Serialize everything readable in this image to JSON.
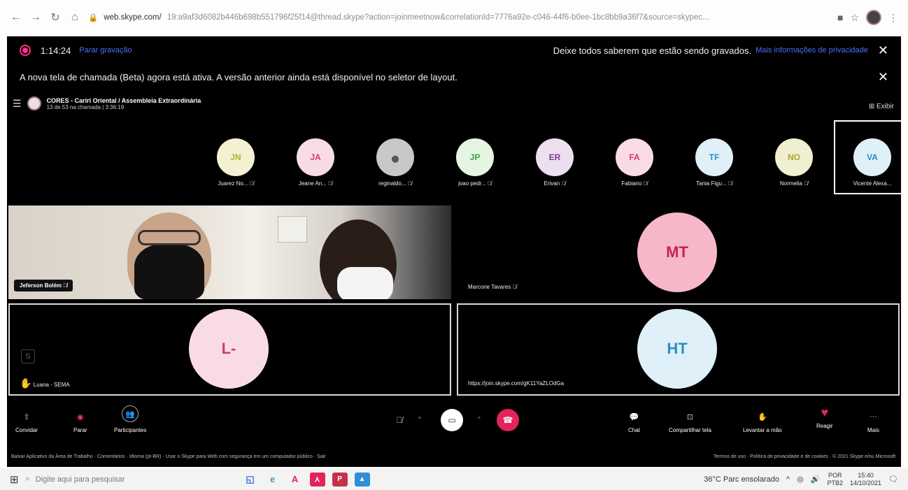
{
  "browser": {
    "url_host": "web.skype.com/",
    "url_rest": "19:a9af3d6082b446b698b551796f25f14@thread.skype?action=joinmeetnow&correlationId=7776a92e-c046-44f6-b0ee-1bc8bb9a36f7&source=skypec..."
  },
  "recording": {
    "time": "1:14:24",
    "stop_label": "Parar gravação",
    "notice": "Deixe todos saberem que estão sendo gravados.",
    "privacy_link": "Mais informações de privacidade"
  },
  "beta_notice": "A nova tela de chamada (Beta) agora está ativa. A versão anterior ainda está disponível no seletor de layout.",
  "call": {
    "title": "CORES - Cariri Oriental / Assembleia Extraordinária",
    "subtitle": "13 de 53 na chamada | 3:36:19",
    "view_label": "Exibir"
  },
  "participants": [
    {
      "initials": "JN",
      "name": "Juarez No...",
      "bg": "#f3f1d2",
      "fg": "#b8b23a"
    },
    {
      "initials": "JA",
      "name": "Jeane An...",
      "bg": "#f9dbe6",
      "fg": "#d23a6e"
    },
    {
      "initials": "",
      "name": "reginaldo...",
      "bg": "#c8c8c8",
      "fg": "#333"
    },
    {
      "initials": "JP",
      "name": "joao pedr...",
      "bg": "#e6f5e2",
      "fg": "#3aa04a"
    },
    {
      "initials": "ER",
      "name": "Erivan",
      "bg": "#ece0f0",
      "fg": "#7a3c8e"
    },
    {
      "initials": "FA",
      "name": "Fabiano",
      "bg": "#f9dbe6",
      "fg": "#d23a6e"
    },
    {
      "initials": "TF",
      "name": "Tania Figu...",
      "bg": "#dff0f8",
      "fg": "#2a8ec0"
    },
    {
      "initials": "NO",
      "name": "Normelia",
      "bg": "#f0efcf",
      "fg": "#aaa53a"
    },
    {
      "initials": "VA",
      "name": "Vicente Alexa...",
      "bg": "#dff0f8",
      "fg": "#2a8ec0"
    }
  ],
  "video_user": "Jeferson Bolém",
  "tiles": {
    "mt": {
      "initials": "MT",
      "name": "Marcone Tavares",
      "bg": "#f6b7c8",
      "fg": "#c32359"
    },
    "l": {
      "initials": "L-",
      "name": "Luana - SEMA",
      "bg": "#f9dbe6",
      "fg": "#d23a6e"
    },
    "ht": {
      "initials": "HT",
      "name": "https://join.skype.com/gK11YaZLOdGa",
      "bg": "#dff0f8",
      "fg": "#2a8ec0"
    }
  },
  "toolbar": {
    "invite": "Convidar",
    "stop": "Parar",
    "participants": "Participantes",
    "chat": "Chat",
    "share": "Compartilhar tela",
    "raise": "Levantar a mão",
    "react": "Reagir",
    "more": "Mais"
  },
  "footer": {
    "left": "Baixar Aplicativo da Área de Trabalho  ·  Comentários  ·  Idioma (pt-BR)  ·  Usar o Skype para Web com segurança em um computador público  ·  Sair",
    "right": "Termos de uso  ·  Política de privacidade e de cookies  ·  © 2021 Skype e/ou Microsoft."
  },
  "taskbar": {
    "search_placeholder": "Digite aqui para pesquisar",
    "weather": "36°C  Parc ensolarado",
    "lang1": "POR",
    "lang2": "PTB2",
    "time": "15:40",
    "date": "14/10/2021"
  },
  "colors": {
    "accent": "#4a70ff",
    "record": "#ff2d8f",
    "hangup": "#e3245c"
  }
}
